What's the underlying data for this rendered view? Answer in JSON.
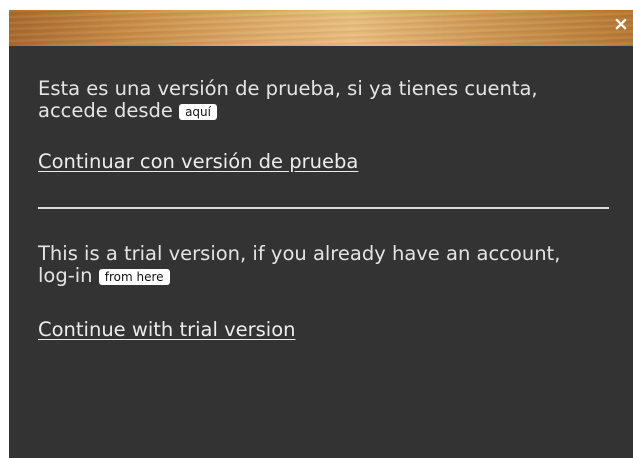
{
  "dialog": {
    "close_symbol": "×",
    "spanish": {
      "message": "Esta es una versión de prueba, si ya tienes cuenta, accede desde",
      "login_button": "aquí",
      "continue_link": "Continuar con versión de prueba"
    },
    "english": {
      "message": "This is a trial version, if you already have an account, log-in",
      "login_button": "from here",
      "continue_link": "Continue with trial version"
    }
  },
  "colors": {
    "background": "#333333",
    "text": "#e4e4e4",
    "header_wood": "#d09a55"
  },
  "icons": {
    "close": "close-icon"
  }
}
